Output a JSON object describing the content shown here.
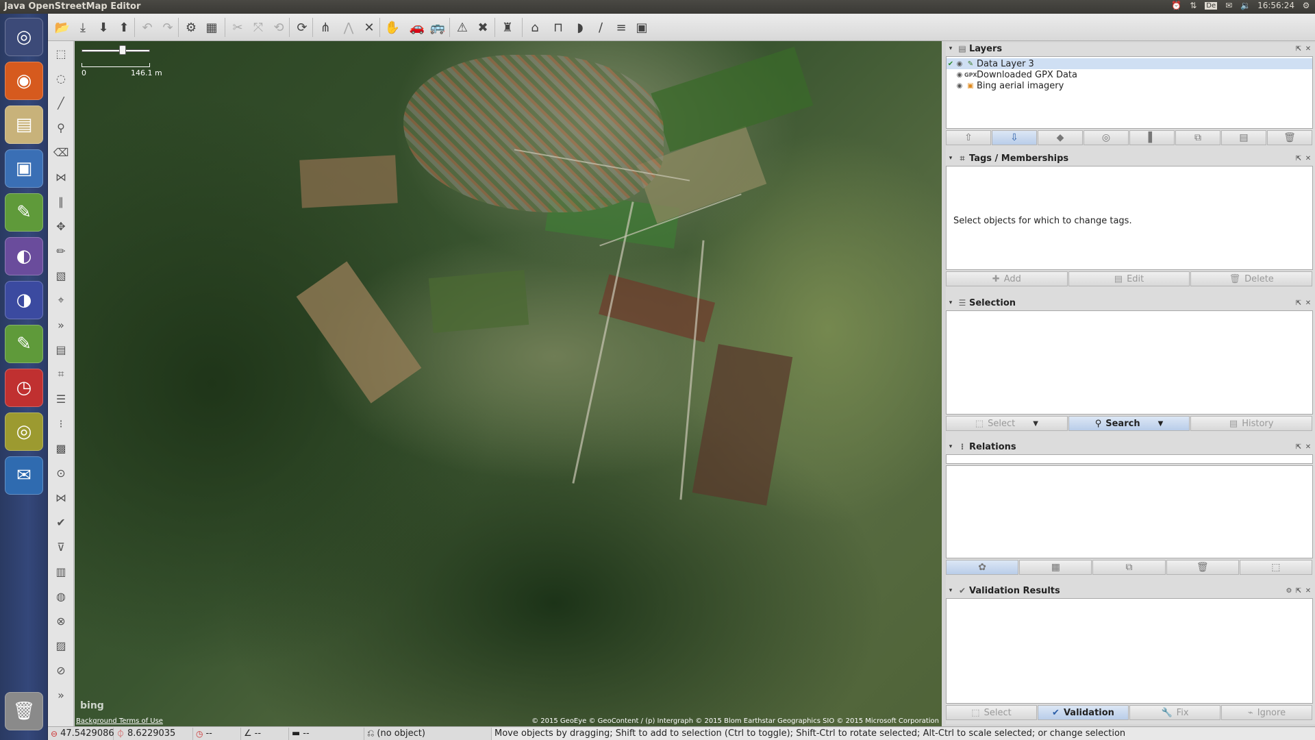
{
  "window": {
    "title": "Java OpenStreetMap Editor"
  },
  "tray": {
    "alarm_icon": "alarm-clock-icon",
    "network_icon": "network-arrows-icon",
    "keyboard": "De",
    "mail_icon": "mail-icon",
    "volume_icon": "volume-icon",
    "time": "16:56:24",
    "settings_icon": "gear-icon"
  },
  "launcher": {
    "items": [
      {
        "name": "ubuntu-dash-icon",
        "glyph": "◎",
        "bg": "#3c4a78"
      },
      {
        "name": "firefox-icon",
        "glyph": "◉",
        "bg": "#d65a1e"
      },
      {
        "name": "file-manager-icon",
        "glyph": "▤",
        "bg": "#c8b27a"
      },
      {
        "name": "image-viewer-icon",
        "glyph": "▣",
        "bg": "#3a6fb5"
      },
      {
        "name": "josm-icon",
        "glyph": "✎",
        "bg": "#5f9a3a"
      },
      {
        "name": "eclipse-icon",
        "glyph": "◐",
        "bg": "#6a4c9c"
      },
      {
        "name": "eclipse-2-icon",
        "glyph": "◑",
        "bg": "#3b4aa0"
      },
      {
        "name": "josm-2-icon",
        "glyph": "✎",
        "bg": "#5f9a3a"
      },
      {
        "name": "alarm-app-icon",
        "glyph": "◷",
        "bg": "#c03030"
      },
      {
        "name": "speaker-icon",
        "glyph": "◎",
        "bg": "#9c9a30"
      },
      {
        "name": "thunderbird-icon",
        "glyph": "✉",
        "bg": "#2f6bb0"
      },
      {
        "name": "trash-icon",
        "glyph": "🗑",
        "bg": "#8a8a8a"
      }
    ]
  },
  "toolbar": {
    "buttons": [
      {
        "name": "open-file-icon",
        "glyph": "📂",
        "enabled": true
      },
      {
        "name": "save-icon",
        "glyph": "⤓",
        "enabled": true
      },
      {
        "name": "download-icon",
        "glyph": "⬇",
        "enabled": true
      },
      {
        "name": "upload-icon",
        "glyph": "⬆",
        "enabled": true
      },
      {
        "name": "undo-icon",
        "glyph": "↶",
        "enabled": false
      },
      {
        "name": "redo-icon",
        "glyph": "↷",
        "enabled": false
      },
      {
        "name": "preferences-icon",
        "glyph": "⚙",
        "enabled": true
      },
      {
        "name": "imagery-icon",
        "glyph": "▦",
        "enabled": true
      },
      {
        "name": "split-way-icon",
        "glyph": "✂",
        "enabled": false
      },
      {
        "name": "combine-way-icon",
        "glyph": "⤧",
        "enabled": false
      },
      {
        "name": "reverse-way-icon",
        "glyph": "⟲",
        "enabled": false
      },
      {
        "name": "update-data-icon",
        "glyph": "⟳",
        "enabled": true
      },
      {
        "name": "highway-preset-icon",
        "glyph": "⋔",
        "enabled": true
      },
      {
        "name": "junction-preset-icon",
        "glyph": "⋀",
        "enabled": false
      },
      {
        "name": "crossing-preset-icon",
        "glyph": "✕",
        "enabled": true
      },
      {
        "name": "hand-icon",
        "glyph": "✋",
        "enabled": true
      },
      {
        "name": "car-icon",
        "glyph": "🚗",
        "enabled": true
      },
      {
        "name": "bus-icon",
        "glyph": "🚌",
        "enabled": true
      },
      {
        "name": "hazard-icon",
        "glyph": "⚠",
        "enabled": true
      },
      {
        "name": "tools-icon",
        "glyph": "✖",
        "enabled": true
      },
      {
        "name": "castle-icon",
        "glyph": "♜",
        "enabled": true
      },
      {
        "name": "industrial-icon",
        "glyph": "⌂",
        "enabled": true
      },
      {
        "name": "bridge-icon",
        "glyph": "⊓",
        "enabled": true
      },
      {
        "name": "tunnel-icon",
        "glyph": "◗",
        "enabled": true
      },
      {
        "name": "waterway-icon",
        "glyph": "∕",
        "enabled": true
      },
      {
        "name": "railway-icon",
        "glyph": "≡",
        "enabled": true
      },
      {
        "name": "map-preset-icon",
        "glyph": "▣",
        "enabled": true
      }
    ]
  },
  "tools": [
    {
      "name": "select-tool-icon",
      "glyph": "⬚"
    },
    {
      "name": "lasso-tool-icon",
      "glyph": "◌"
    },
    {
      "name": "draw-line-tool-icon",
      "glyph": "╱"
    },
    {
      "name": "zoom-tool-icon",
      "glyph": "⚲"
    },
    {
      "name": "delete-tool-icon",
      "glyph": "⌫"
    },
    {
      "name": "draw-nodes-tool-icon",
      "glyph": "⋈"
    },
    {
      "name": "parallel-tool-icon",
      "glyph": "∥"
    },
    {
      "name": "improve-way-tool-icon",
      "glyph": "✥"
    },
    {
      "name": "pencil-tool-icon",
      "glyph": "✏"
    },
    {
      "name": "building-tool-icon",
      "glyph": "▧"
    },
    {
      "name": "address-tool-icon",
      "glyph": "⌖"
    },
    {
      "name": "more-tools-icon",
      "glyph": "»"
    },
    {
      "name": "toggle-layers-icon",
      "glyph": "▤"
    },
    {
      "name": "tag-icon",
      "glyph": "⌗"
    },
    {
      "name": "selection-list-icon",
      "glyph": "☰"
    },
    {
      "name": "relations-list-icon",
      "glyph": "⁝"
    },
    {
      "name": "photo-icon",
      "glyph": "▩"
    },
    {
      "name": "history-icon",
      "glyph": "⊙"
    },
    {
      "name": "conflict-icon",
      "glyph": "⋈"
    },
    {
      "name": "validation-icon",
      "glyph": "✔"
    },
    {
      "name": "filter-icon",
      "glyph": "⊽"
    },
    {
      "name": "plugin-icon",
      "glyph": "▥"
    },
    {
      "name": "globe-icon",
      "glyph": "◍"
    },
    {
      "name": "map-marker-icon",
      "glyph": "⊗"
    },
    {
      "name": "changeset-icon",
      "glyph": "▨"
    },
    {
      "name": "notes-icon",
      "glyph": "⊘"
    },
    {
      "name": "more-panels-icon",
      "glyph": "»"
    }
  ],
  "map": {
    "scale_start": "0",
    "scale_end": "146.1 m",
    "provider_logo": "bing",
    "terms_link": "Background Terms of Use",
    "attribution": "© 2015 GeoEye © GeoContent / (p) Intergraph © 2015 Blom Earthstar Geographics  SIO © 2015 Microsoft Corporation"
  },
  "layers": {
    "title": "Layers",
    "items": [
      {
        "label": "Data Layer 3",
        "icon": "data-layer-icon",
        "selected": true
      },
      {
        "label": "Downloaded GPX Data",
        "icon": "gpx-icon",
        "badge": "GPX",
        "selected": false
      },
      {
        "label": "Bing aerial imagery",
        "icon": "imagery-layer-icon",
        "selected": false
      }
    ],
    "buttons": [
      {
        "name": "move-up-icon",
        "glyph": "⇧"
      },
      {
        "name": "move-down-icon",
        "glyph": "⇩"
      },
      {
        "name": "activate-icon",
        "glyph": "◆"
      },
      {
        "name": "toggle-visible-icon",
        "glyph": "◎"
      },
      {
        "name": "opacity-icon",
        "glyph": "▌"
      },
      {
        "name": "merge-icon",
        "glyph": "⧉"
      },
      {
        "name": "duplicate-icon",
        "glyph": "▤"
      },
      {
        "name": "delete-layer-icon",
        "glyph": "🗑"
      }
    ]
  },
  "tags": {
    "title": "Tags / Memberships",
    "hint": "Select objects for which to change tags.",
    "add": "Add",
    "edit": "Edit",
    "delete": "Delete"
  },
  "selection": {
    "title": "Selection",
    "select": "Select",
    "search": "Search",
    "history": "History"
  },
  "relations": {
    "title": "Relations",
    "buttons": [
      {
        "name": "new-relation-icon",
        "glyph": "✿"
      },
      {
        "name": "edit-relation-icon",
        "glyph": "▦"
      },
      {
        "name": "duplicate-relation-icon",
        "glyph": "⧉"
      },
      {
        "name": "delete-relation-icon",
        "glyph": "🗑"
      },
      {
        "name": "select-relation-icon",
        "glyph": "⬚"
      }
    ]
  },
  "validation": {
    "title": "Validation Results",
    "select": "Select",
    "validation": "Validation",
    "fix": "Fix",
    "ignore": "Ignore"
  },
  "status": {
    "lat": "47.5429086",
    "lon": "8.6229035",
    "heading": "--",
    "angle": "--",
    "length": "--",
    "object": "(no object)",
    "message": "Move objects by dragging; Shift to add to selection (Ctrl to toggle); Shift-Ctrl to rotate selected; Alt-Ctrl to scale selected; or change selection"
  }
}
